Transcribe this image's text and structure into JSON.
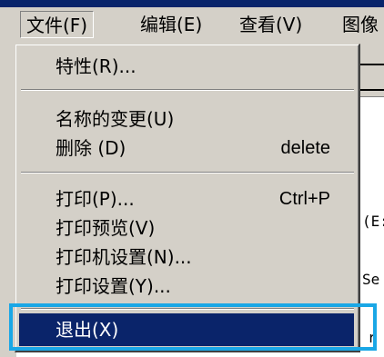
{
  "menubar": {
    "items": [
      {
        "label": "文件(F)"
      },
      {
        "label": "编辑(E)"
      },
      {
        "label": "查看(V)"
      },
      {
        "label": "图像"
      }
    ]
  },
  "background": {
    "doc_text": [
      "(E:",
      "Se",
      "r"
    ]
  },
  "menu": {
    "items": [
      {
        "label": "特性(R)...",
        "shortcut": ""
      },
      {
        "label": "名称的变更(U)",
        "shortcut": ""
      },
      {
        "label": "删除 (D)",
        "shortcut": "delete"
      },
      {
        "label": "打印(P)...",
        "shortcut": "Ctrl+P"
      },
      {
        "label": "打印预览(V)",
        "shortcut": ""
      },
      {
        "label": "打印机设置(N)...",
        "shortcut": ""
      },
      {
        "label": "打印设置(Y)...",
        "shortcut": ""
      },
      {
        "label": "退出(X)",
        "shortcut": "",
        "selected": true
      }
    ]
  },
  "colors": {
    "menu_bg": "#d4d0c8",
    "selection": "#0a246a",
    "highlight_box": "#1aa7e6"
  }
}
